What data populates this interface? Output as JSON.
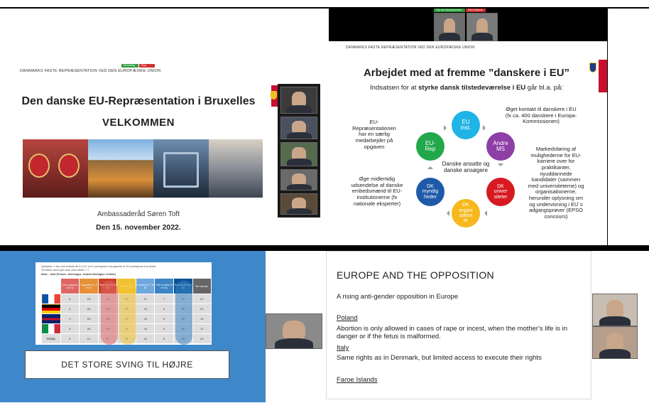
{
  "slide1": {
    "header": "DANMARKS FASTE REPRÆSENTATION VED DEN EUROPÆISKE UNION",
    "recording_pill": "Recording in progress",
    "stop_pill": "Stop Share",
    "title": "Den danske EU-Repræsentation i Bruxelles",
    "subtitle": "VELKOMMEN",
    "speaker": "Ambassaderåd Søren Toft",
    "date": "Den 15. november 2022."
  },
  "slide2": {
    "header": "DANMARKS FASTE REPRÆSENTATION VED DEN EUROPÆISKE UNION",
    "title": "Arbejdet med at fremme ”danskere i EU”",
    "intro_pre": "Indsatsen for at ",
    "intro_bold": "styrke dansk tilstedeværelse i EU",
    "intro_post": " går bl.a. på:",
    "center": "Danske ansatte og\ndanske ansøgere",
    "cycle": [
      {
        "label": "EU\ninst.",
        "color": "#1fb4e5"
      },
      {
        "label": "Andre\nMS",
        "color": "#8d3fa5"
      },
      {
        "label": "DK\nuniver\nsiteter",
        "color": "#d71920"
      },
      {
        "label": "DK\norgani\nsation\ner",
        "color": "#f6b81c"
      },
      {
        "label": "DK\nmyndig\nheder",
        "color": "#1f5aa8"
      },
      {
        "label": "EU-\nRep",
        "color": "#22a84b"
      }
    ],
    "notes": {
      "top_left": "EU-\nRepræsentationen\nhar en særlig\nmedarbejder på\nopgaven",
      "top_right": "Øget kontakt til danskere i EU\n(fx ca. 400 danskere i Europa-\nKommissionen)",
      "right": "Markedsføring af\nmulighederne for EU-\nkarriere over for\npraktikanter,\nnyuddannede\nkandidater (sammen\nmed universiteterne) og\norganisationerne,\nherunder oplysning om\nog undervisning i EU´s\nadgangsprøver (EPSO\nconcours)",
      "left": "Øge midlertidig\nudsendelse af danske\nembedsmænd til EU-\ninstitutionerne (fx\nnationale eksperter)"
    }
  },
  "slide3": {
    "question": "Question: « Sur une échelle de 0 à 10, où 0 correspond à la gauche et 10 correspond à la droite,\nOù diriez-vous que vous vous situez ? »",
    "base": "Base : total (France, Allemagne, Grande-Bretagne et Italie)",
    "columns": [
      "Très à gauche (0 à 1)",
      "À gauche (2, 3 et 4)",
      "Total gauche (0 à 4)",
      "Centre (5)",
      "À droite (6, 7 et 8)",
      "Très à droite (9 et 10)",
      "Total droite (6 à 10)",
      "Ne sait pas"
    ],
    "rows": [
      {
        "flag": "france",
        "values": [
          "6",
          "15",
          "21",
          "32",
          "17",
          "7",
          "23",
          "21"
        ]
      },
      {
        "flag": "germany",
        "values": [
          "4",
          "25",
          "30",
          "23",
          "23",
          "4",
          "28",
          "21"
        ]
      },
      {
        "flag": "uk",
        "values": [
          "3",
          "25",
          "28",
          "23",
          "24",
          "5",
          "30",
          "19"
        ]
      },
      {
        "flag": "italy",
        "values": [
          "5",
          "25",
          "30",
          "15",
          "24",
          "5",
          "36",
          "17"
        ]
      },
      {
        "flag": "total",
        "values": [
          "5",
          "21",
          "27",
          "26",
          "23",
          "5",
          "28",
          "20"
        ]
      }
    ],
    "row_total_label": "TOTAL",
    "banner": "DET STORE SVING TIL HØJRE"
  },
  "slide4": {
    "title": "EUROPE AND THE OPPOSITION",
    "lead": "A rising anti-gender opposition in Europe",
    "sections": [
      {
        "heading": "Poland",
        "text": "Abortion is only allowed in cases of rape or incest, when the mother's life is in danger or if the fetus is malformed."
      },
      {
        "heading": "Italy",
        "text": "Same rights as in Denmark, but limited access to execute their rights"
      },
      {
        "heading": "Faroe Islands",
        "text": ""
      }
    ]
  },
  "top_video": {
    "recording_pill": "You are viewing screen",
    "stop_pill": "View Options"
  },
  "colors": {
    "denmark_red": "#c8102e",
    "slide3_bg": "#3e87c9",
    "cycle_arrow": "#9c9c9c"
  }
}
